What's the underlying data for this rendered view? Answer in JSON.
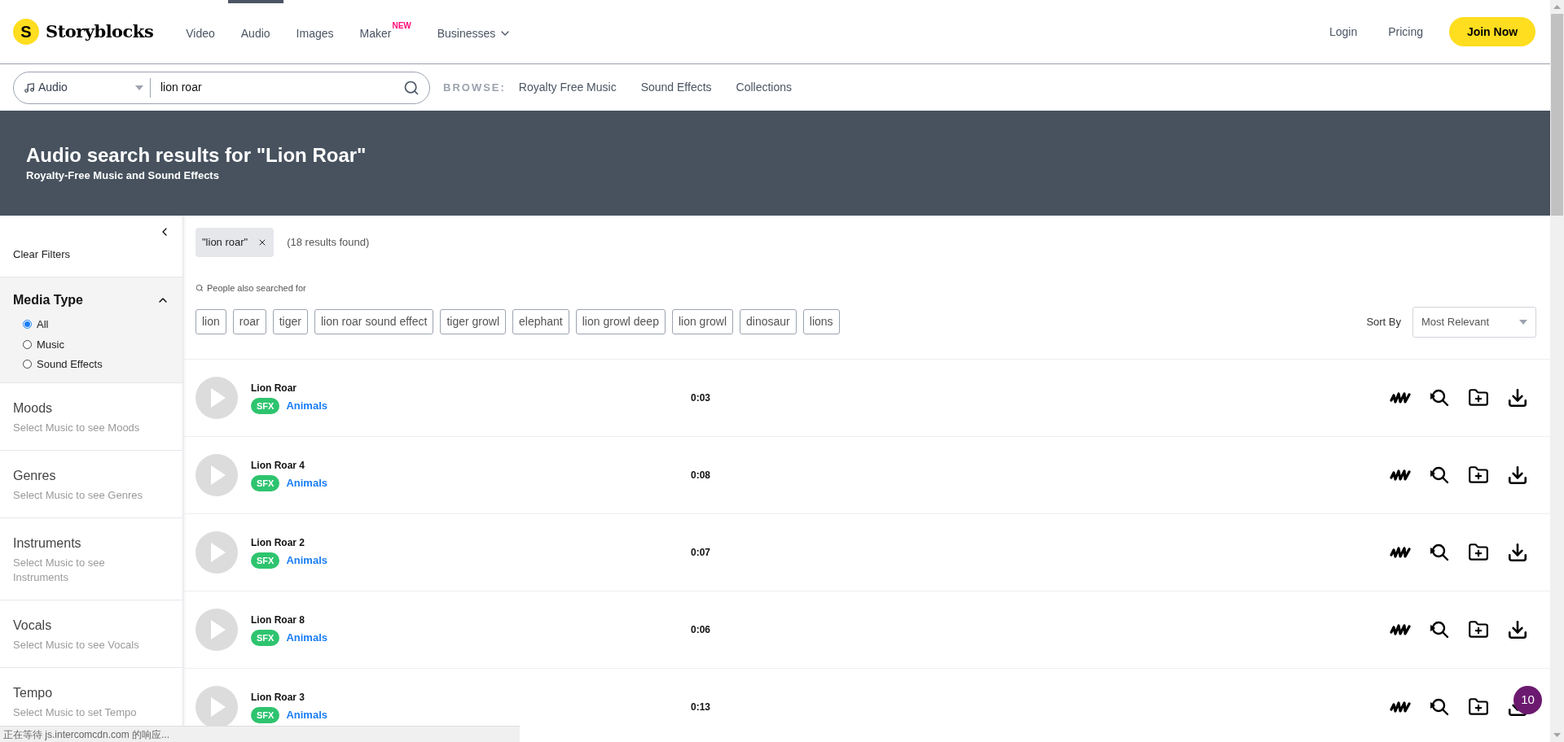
{
  "header": {
    "logo": {
      "mark": "S",
      "name": "Storyblocks"
    },
    "nav": [
      {
        "label": "Video",
        "selected": false
      },
      {
        "label": "Audio",
        "selected": true
      },
      {
        "label": "Images",
        "selected": false
      },
      {
        "label": "Maker",
        "badge": "NEW",
        "selected": false
      },
      {
        "label": "Businesses",
        "dropdown": true,
        "selected": false
      }
    ],
    "actions": {
      "login": "Login",
      "pricing": "Pricing",
      "join": "Join Now"
    }
  },
  "search": {
    "category": "Audio",
    "query": "lion roar",
    "browse_label": "BROWSE:",
    "browse_links": [
      "Royalty Free Music",
      "Sound Effects",
      "Collections"
    ]
  },
  "banner": {
    "title": "Audio search results for \"Lion Roar\"",
    "subtitle": "Royalty-Free Music and Sound Effects"
  },
  "sidebar": {
    "clear": "Clear Filters",
    "media_type": {
      "title": "Media Type",
      "expanded": true,
      "options": [
        {
          "label": "All",
          "selected": true
        },
        {
          "label": "Music",
          "selected": false
        },
        {
          "label": "Sound Effects",
          "selected": false
        }
      ]
    },
    "sections": [
      {
        "title": "Moods",
        "hint": "Select Music to see Moods"
      },
      {
        "title": "Genres",
        "hint": "Select Music to see Genres"
      },
      {
        "title": "Instruments",
        "hint": "Select Music to see Instruments"
      },
      {
        "title": "Vocals",
        "hint": "Select Music to see Vocals"
      },
      {
        "title": "Tempo",
        "hint": "Select Music to set Tempo"
      }
    ]
  },
  "results": {
    "filter_chip": "\"lion roar\"",
    "count": "(18 results found)",
    "also_searched_label": "People also searched for",
    "suggestions": [
      "lion",
      "roar",
      "tiger",
      "lion roar sound effect",
      "tiger growl",
      "elephant",
      "lion growl deep",
      "lion growl",
      "dinosaur",
      "lions"
    ],
    "sort_label": "Sort By",
    "sort_value": "Most Relevant",
    "tracks": [
      {
        "title": "Lion Roar",
        "tag": "SFX",
        "category": "Animals",
        "duration": "0:03"
      },
      {
        "title": "Lion Roar 4",
        "tag": "SFX",
        "category": "Animals",
        "duration": "0:08"
      },
      {
        "title": "Lion Roar 2",
        "tag": "SFX",
        "category": "Animals",
        "duration": "0:07"
      },
      {
        "title": "Lion Roar 8",
        "tag": "SFX",
        "category": "Animals",
        "duration": "0:06"
      },
      {
        "title": "Lion Roar 3",
        "tag": "SFX",
        "category": "Animals",
        "duration": "0:13"
      }
    ]
  },
  "chat_badge": "10",
  "status_bar": "正在等待 js.intercomcdn.com 的响应..."
}
